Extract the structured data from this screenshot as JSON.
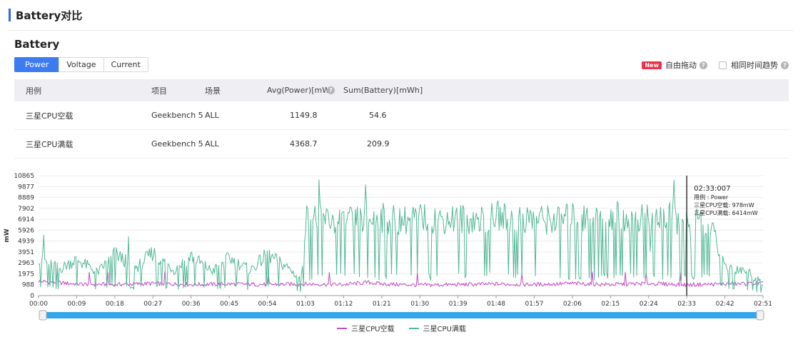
{
  "header": {
    "title": "Battery对比"
  },
  "section": {
    "title": "Battery"
  },
  "tabs": [
    {
      "label": "Power",
      "active": true
    },
    {
      "label": "Voltage",
      "active": false
    },
    {
      "label": "Current",
      "active": false
    }
  ],
  "tools": {
    "new_badge": "New",
    "free_drag_label": "自由拖动",
    "same_time_label": "相同时间趋势"
  },
  "table": {
    "columns": [
      "用例",
      "项目",
      "场景",
      "Avg(Power)[mW]",
      "Sum(Battery)[mWh]"
    ],
    "rows": [
      [
        "三星CPU空载",
        "Geekbench 5",
        "ALL",
        "1149.8",
        "54.6"
      ],
      [
        "三星CPU满载",
        "Geekbench 5",
        "ALL",
        "4368.7",
        "209.9"
      ]
    ]
  },
  "colors": {
    "accent": "#3d7bf0",
    "idle": "#c34bc8",
    "full": "#52b894",
    "new": "#e8334a",
    "slider": "#35a6ec"
  },
  "chart_data": {
    "type": "line",
    "ylabel": "mW",
    "yticks": [
      "10865",
      "9877",
      "8889",
      "7902",
      "6914",
      "5926",
      "4939",
      "3951",
      "2963",
      "1975",
      "988",
      "0"
    ],
    "ylim": [
      0,
      10865
    ],
    "xticks": [
      "00:00",
      "00:09",
      "00:18",
      "00:27",
      "00:36",
      "00:45",
      "00:54",
      "01:03",
      "01:12",
      "01:21",
      "01:30",
      "01:39",
      "01:48",
      "01:57",
      "02:06",
      "02:15",
      "02:24",
      "02:33",
      "02:42",
      "02:51"
    ],
    "xlim_seconds": [
      0,
      171
    ],
    "series": [
      {
        "name": "三星CPU空载",
        "color": "#c34bc8",
        "x": [
          0,
          9,
          18,
          27,
          36,
          45,
          54,
          63,
          72,
          78,
          81,
          90,
          99,
          108,
          117,
          126,
          135,
          144,
          153,
          162,
          171
        ],
        "y": [
          1300,
          1050,
          1000,
          1100,
          1000,
          1050,
          1000,
          1050,
          1000,
          1200,
          1050,
          950,
          1000,
          1050,
          1000,
          1100,
          1000,
          1100,
          978,
          1050,
          1100
        ]
      },
      {
        "name": "三星CPU满载",
        "color": "#52b894",
        "x": [
          0,
          5,
          9,
          14,
          18,
          23,
          27,
          32,
          36,
          41,
          45,
          50,
          54,
          59,
          62,
          63,
          66,
          72,
          76,
          81,
          86,
          90,
          95,
          99,
          104,
          108,
          113,
          117,
          122,
          126,
          131,
          135,
          140,
          144,
          149,
          153,
          158,
          162,
          167,
          171
        ],
        "y": [
          3500,
          2400,
          3300,
          2100,
          3800,
          2500,
          3900,
          2300,
          3600,
          2200,
          3400,
          2300,
          3700,
          2500,
          1400,
          7000,
          7000,
          6700,
          6800,
          7000,
          6800,
          7100,
          6900,
          7000,
          6800,
          7200,
          6900,
          7000,
          6800,
          7100,
          6900,
          7300,
          7000,
          6900,
          7100,
          6414,
          7000,
          2600,
          2300,
          1100
        ]
      }
    ],
    "tooltip": {
      "time": "02:33:007",
      "rows": [
        "用例            : Power",
        "三星CPU空载: 978mW",
        "三星CPU满载: 6414mW"
      ],
      "at_seconds": 153
    },
    "legend": [
      "三星CPU空载",
      "三星CPU满载"
    ],
    "legend_position": "bottom",
    "grid": true
  }
}
